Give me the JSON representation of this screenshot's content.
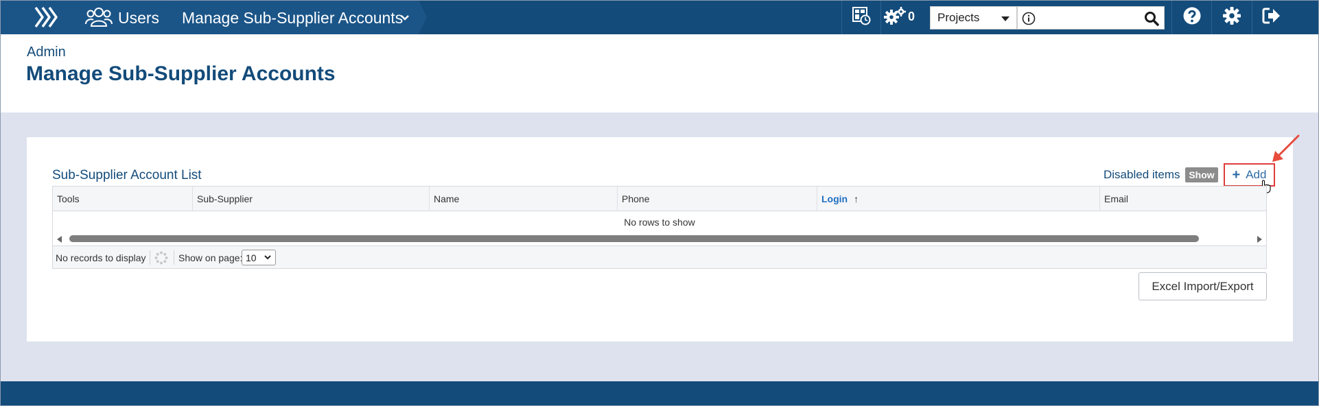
{
  "topbar": {
    "breadcrumb": {
      "users_label": "Users",
      "page_label": "Manage Sub-Supplier Accounts"
    },
    "tasks_count": "0",
    "projects_select": {
      "value": "Projects"
    },
    "search": {
      "placeholder": "",
      "value": ""
    },
    "icons": [
      "logo-chevrons-icon",
      "users-icon",
      "chevron-down-icon",
      "dashboard-clock-icon",
      "gears-icon",
      "info-icon",
      "search-icon",
      "help-icon",
      "settings-gear-icon",
      "logout-icon"
    ]
  },
  "header": {
    "section": "Admin",
    "title": "Manage Sub-Supplier Accounts"
  },
  "panel": {
    "list_title": "Sub-Supplier Account List",
    "disabled_items_label": "Disabled items",
    "show_button": "Show",
    "add_button": "Add",
    "columns": [
      "Tools",
      "Sub-Supplier",
      "Name",
      "Phone",
      "Login",
      "Email"
    ],
    "sorted_column": "Login",
    "empty_message": "No rows to show",
    "footer": {
      "records_text": "No records to display",
      "show_on_page_label": "Show on page:",
      "page_size": "10"
    },
    "excel_button": "Excel Import/Export"
  },
  "colors": {
    "nav": "#134b7a",
    "accent": "#2e6ca4",
    "highlight": "#e03c3c"
  }
}
